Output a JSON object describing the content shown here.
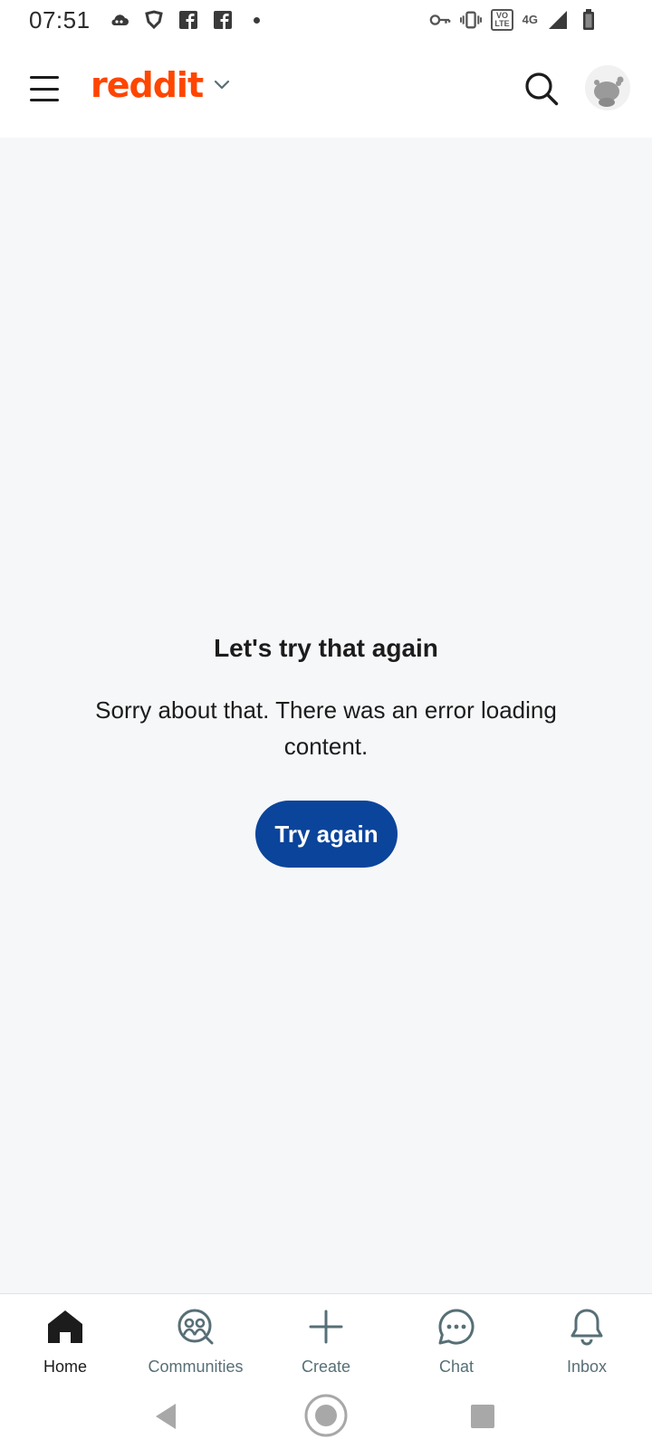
{
  "status_bar": {
    "time": "07:51",
    "left_icons": [
      "cloud-icon",
      "shield-icon",
      "facebook-icon",
      "facebook-icon",
      "dot-icon"
    ],
    "right_icons": [
      "vpn-key-icon",
      "vibrate-icon",
      "volte-icon",
      "network-4g-icon",
      "signal-icon",
      "battery-icon"
    ],
    "volte_text_top": "VO",
    "volte_text_bottom": "LTE",
    "network_text": "4G"
  },
  "header": {
    "brand": "reddit",
    "brand_color": "#ff4500",
    "menu_icon": "hamburger-menu-icon",
    "dropdown_icon": "chevron-down-icon",
    "search_icon": "search-icon",
    "avatar_icon": "snoo-avatar-icon"
  },
  "error": {
    "title": "Let's try that again",
    "message": "Sorry about that. There was an error loading content.",
    "retry_label": "Try again",
    "retry_color": "#0b449b"
  },
  "bottom_nav": {
    "items": [
      {
        "label": "Home",
        "icon": "home-icon",
        "active": true
      },
      {
        "label": "Communities",
        "icon": "communities-icon",
        "active": false
      },
      {
        "label": "Create",
        "icon": "plus-icon",
        "active": false
      },
      {
        "label": "Chat",
        "icon": "chat-icon",
        "active": false
      },
      {
        "label": "Inbox",
        "icon": "bell-icon",
        "active": false
      }
    ]
  },
  "system_nav": {
    "buttons": [
      "back-icon",
      "home-circle-icon",
      "recents-icon"
    ]
  }
}
